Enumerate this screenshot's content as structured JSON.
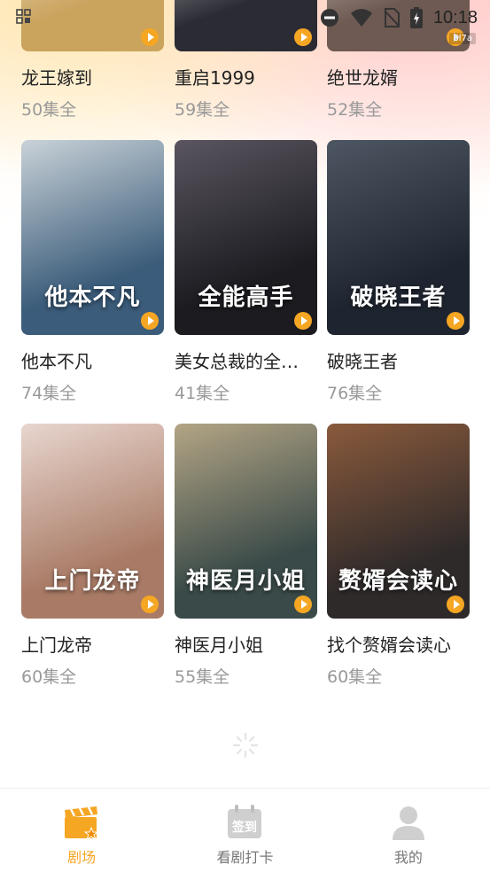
{
  "status_bar": {
    "time": "10:18",
    "icons": [
      "grid-icon",
      "dnd-icon",
      "wifi-icon",
      "no-sim-icon",
      "battery-charging-icon"
    ],
    "watermark": "8l7a"
  },
  "dramas": [
    {
      "title": "龙王嫁到",
      "episodes": "50集全",
      "colors": [
        "#caa35d",
        "#ffffff"
      ],
      "art": ""
    },
    {
      "title": "重启1999",
      "episodes": "59集全",
      "colors": [
        "#2b2b34",
        "#ffffff"
      ],
      "art": ""
    },
    {
      "title": "绝世龙婿",
      "episodes": "52集全",
      "colors": [
        "#6e5a52",
        "#ffffff"
      ],
      "art": ""
    },
    {
      "title": "他本不凡",
      "episodes": "74集全",
      "colors": [
        "#3b5c7a",
        "#c9d2d8"
      ],
      "art": "他本不凡"
    },
    {
      "title": "美女总裁的全…",
      "episodes": "41集全",
      "colors": [
        "#1b1b20",
        "#5a5560"
      ],
      "art": "全能高手"
    },
    {
      "title": "破晓王者",
      "episodes": "76集全",
      "colors": [
        "#1f2530",
        "#4d5662"
      ],
      "art": "破晓王者"
    },
    {
      "title": "上门龙帝",
      "episodes": "60集全",
      "colors": [
        "#a97b66",
        "#e8d6cf"
      ],
      "art": "上门龙帝"
    },
    {
      "title": "神医月小姐",
      "episodes": "55集全",
      "colors": [
        "#3a4a48",
        "#b3a585"
      ],
      "art": "神医月小姐"
    },
    {
      "title": "找个赘婿会读心",
      "episodes": "60集全",
      "colors": [
        "#2f2a2a",
        "#8a5a3c"
      ],
      "art": "赘婿会读心"
    }
  ],
  "tabbar": {
    "tabs": [
      {
        "label": "剧场",
        "icon": "clapperboard-icon",
        "active": true
      },
      {
        "label": "看剧打卡",
        "icon": "calendar-checkin-icon",
        "active": false,
        "icon_text": "签到"
      },
      {
        "label": "我的",
        "icon": "user-icon",
        "active": false
      }
    ]
  },
  "colors": {
    "accent": "#f5a623",
    "muted": "#999999",
    "text": "#222222"
  }
}
